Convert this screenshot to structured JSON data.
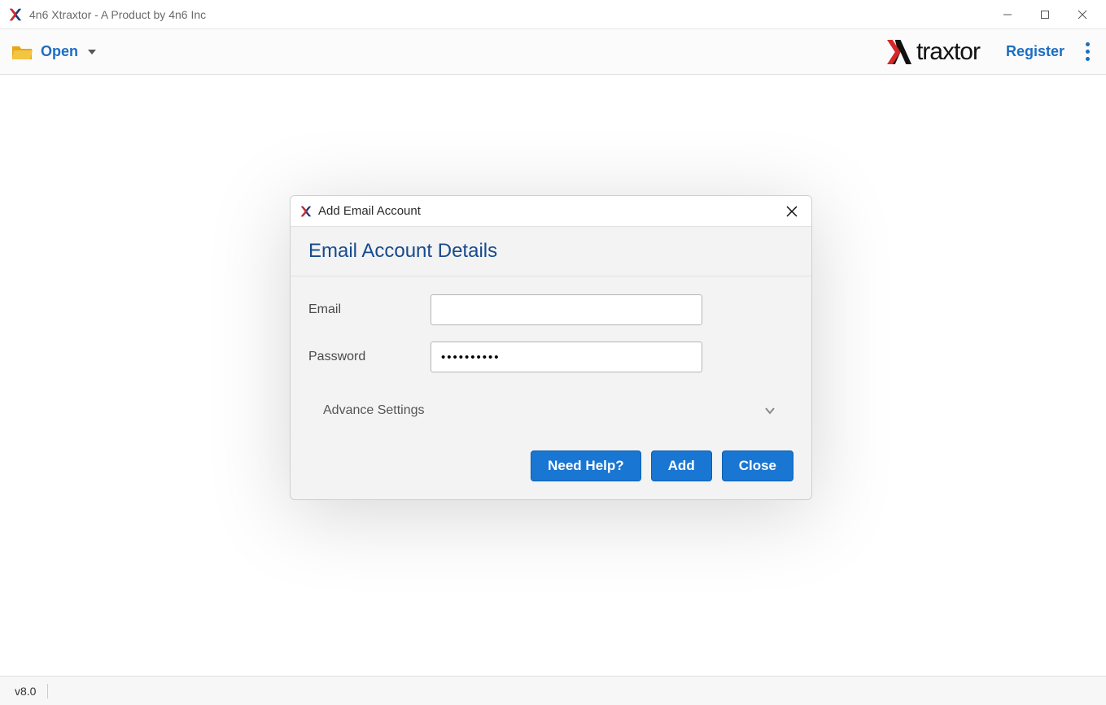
{
  "window": {
    "title": "4n6 Xtraxtor - A Product by 4n6 Inc"
  },
  "toolbar": {
    "open_label": "Open",
    "brand_text": "traxtor",
    "register_label": "Register"
  },
  "dialog": {
    "titlebar_title": "Add Email Account",
    "heading": "Email Account Details",
    "email_label": "Email",
    "email_value": "",
    "password_label": "Password",
    "password_value": "••••••••••",
    "advance_label": "Advance Settings",
    "buttons": {
      "help": "Need Help?",
      "add": "Add",
      "close": "Close"
    }
  },
  "statusbar": {
    "version": "v8.0"
  }
}
